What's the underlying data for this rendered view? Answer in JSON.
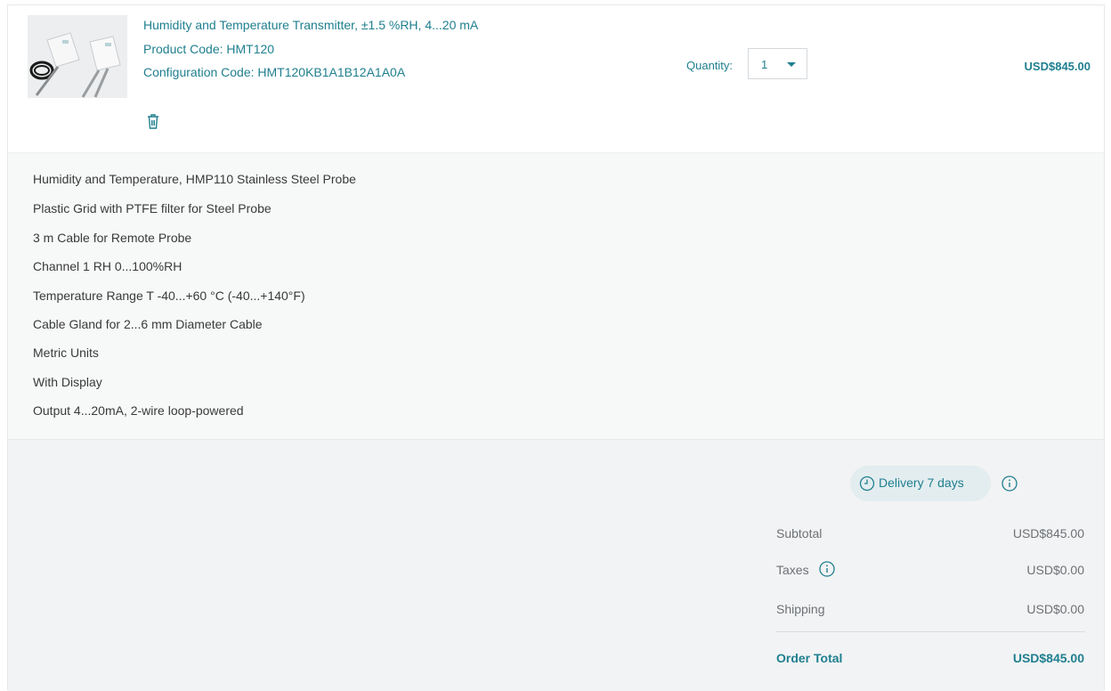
{
  "product": {
    "title": "Humidity and Temperature Transmitter, ±1.5 %RH, 4...20 mA",
    "product_code": "Product Code: HMT120",
    "configuration_code": "Configuration Code: HMT120KB1A1B12A1A0A",
    "quantity_label": "Quantity:",
    "quantity_value": "1",
    "price": "USD$845.00",
    "delete_icon": "trash-icon"
  },
  "options": [
    "Humidity and Temperature, HMP110 Stainless Steel Probe",
    "Plastic Grid with PTFE filter for Steel Probe",
    "3 m Cable for Remote Probe",
    "Channel 1 RH 0...100%RH",
    "Temperature Range T -40...+60 °C (-40...+140°F)",
    "Cable Gland for 2...6 mm Diameter Cable",
    "Metric Units",
    "With Display",
    "Output 4...20mA, 2-wire loop-powered"
  ],
  "summary": {
    "delivery": "Delivery 7 days",
    "subtotal_label": "Subtotal",
    "subtotal_value": "USD$845.00",
    "taxes_label": "Taxes",
    "taxes_value": "USD$0.00",
    "shipping_label": "Shipping",
    "shipping_value": "USD$0.00",
    "total_label": "Order Total",
    "total_value": "USD$845.00"
  },
  "colors": {
    "accent": "#1f7f8f",
    "text": "#3a3a3a",
    "muted": "#6d7175",
    "options_bg": "#f7f8f8",
    "summary_bg": "#f2f3f4"
  }
}
